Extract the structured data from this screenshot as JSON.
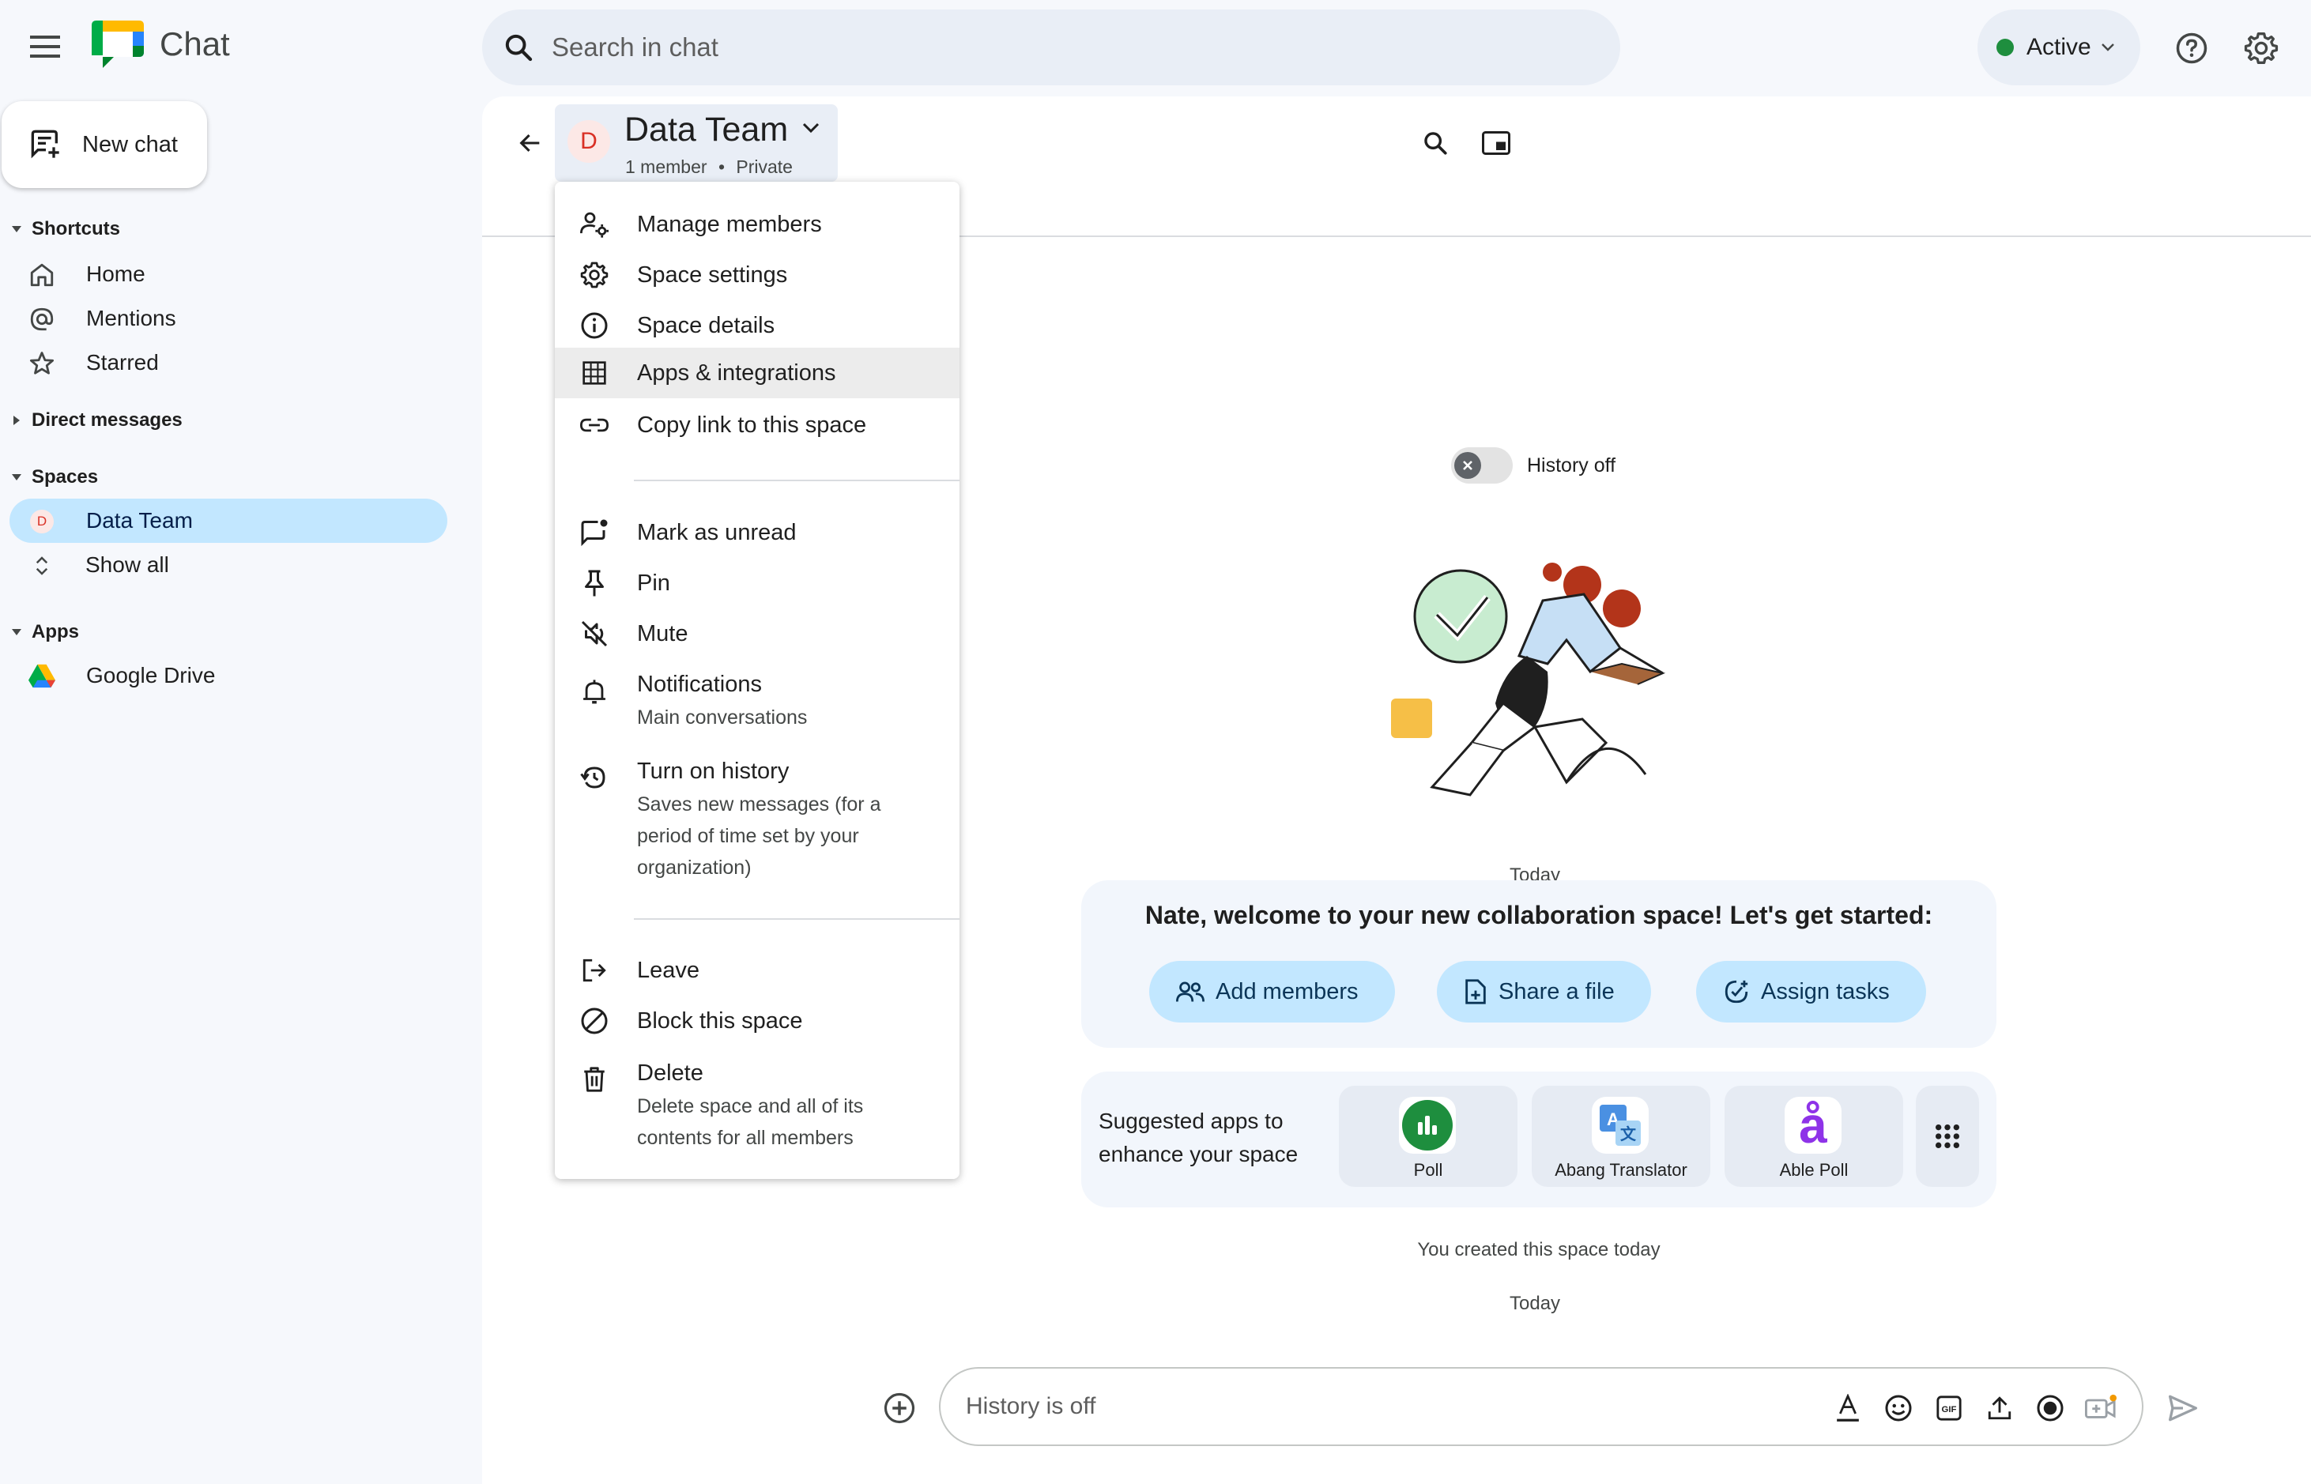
{
  "app": {
    "name": "Chat"
  },
  "search": {
    "placeholder": "Search in chat"
  },
  "status": {
    "label": "Active",
    "color": "#1e8e3e"
  },
  "sidebar": {
    "new_chat_label": "New chat",
    "shortcuts": {
      "title": "Shortcuts",
      "items": [
        {
          "label": "Home",
          "icon": "home-icon"
        },
        {
          "label": "Mentions",
          "icon": "at-sign-icon"
        },
        {
          "label": "Starred",
          "icon": "star-icon"
        }
      ]
    },
    "direct_messages": {
      "title": "Direct messages"
    },
    "spaces": {
      "title": "Spaces",
      "items": [
        {
          "label": "Data Team",
          "avatar": "D",
          "selected": true
        },
        {
          "label": "Show all",
          "icon": "expand-icon"
        }
      ]
    },
    "apps": {
      "title": "Apps",
      "items": [
        {
          "label": "Google Drive",
          "icon": "google-drive-icon"
        }
      ]
    }
  },
  "space": {
    "avatar": "D",
    "name": "Data Team",
    "members": "1 member",
    "separator": "•",
    "privacy": "Private"
  },
  "menu": {
    "items": [
      {
        "label": "Manage members",
        "icon": "manage-members-icon"
      },
      {
        "label": "Space settings",
        "icon": "gear-icon"
      },
      {
        "label": "Space details",
        "icon": "info-icon"
      },
      {
        "label": "Apps & integrations",
        "icon": "apps-grid-icon",
        "highlighted": true
      },
      {
        "label": "Copy link to this space",
        "icon": "link-icon"
      },
      {
        "label": "Mark as unread",
        "icon": "mark-unread-icon"
      },
      {
        "label": "Pin",
        "icon": "pin-icon"
      },
      {
        "label": "Mute",
        "icon": "mute-icon"
      },
      {
        "label": "Notifications",
        "sub": "Main conversations",
        "icon": "bell-icon"
      },
      {
        "label": "Turn on history",
        "sub": "Saves new messages (for a period of time set by your organization)",
        "icon": "history-icon"
      },
      {
        "label": "Leave",
        "icon": "leave-icon"
      },
      {
        "label": "Block this space",
        "icon": "block-icon"
      },
      {
        "label": "Delete",
        "sub": "Delete space and all of its contents for all members",
        "icon": "trash-icon"
      }
    ]
  },
  "history": {
    "label": "History off",
    "on": false
  },
  "conversation": {
    "today_label_1": "Today",
    "welcome": "Nate, welcome to your new collaboration space! Let's get started:",
    "actions": [
      {
        "label": "Add members",
        "icon": "add-people-icon"
      },
      {
        "label": "Share a file",
        "icon": "file-icon"
      },
      {
        "label": "Assign tasks",
        "icon": "task-icon"
      }
    ],
    "suggested_label": "Suggested apps to enhance your space",
    "apps": [
      {
        "label": "Poll",
        "icon": "poll-icon"
      },
      {
        "label": "Abang Translator",
        "icon": "translator-icon"
      },
      {
        "label": "Able Poll",
        "icon": "able-poll-icon",
        "glyph": "å"
      }
    ],
    "created": "You created this space today",
    "today_label_2": "Today"
  },
  "composer": {
    "placeholder": "History is off"
  },
  "colors": {
    "accent_light": "#c2e7ff",
    "background": "#f6f8fc",
    "menu_highlight": "#ececec"
  }
}
